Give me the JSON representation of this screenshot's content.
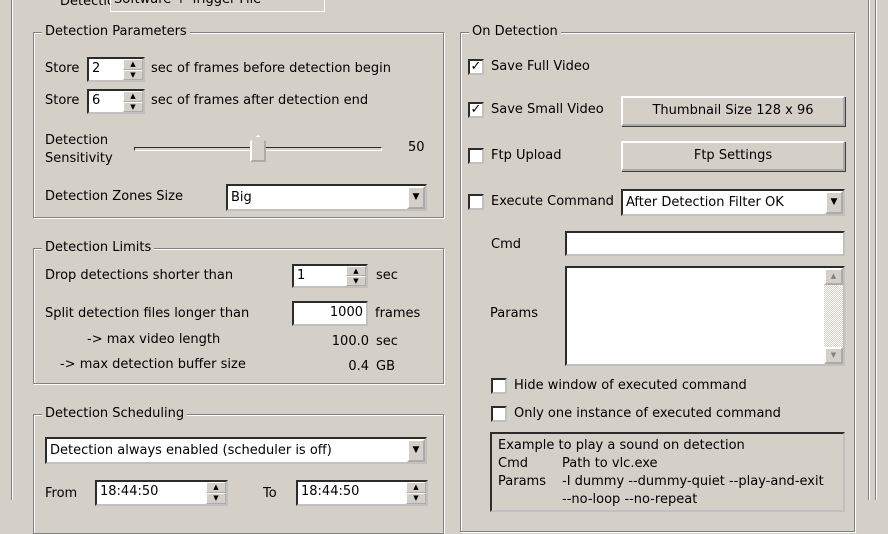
{
  "top": {
    "detection_label": "Detection",
    "detection_value": "Software + Trigger File"
  },
  "params": {
    "title": "Detection Parameters",
    "store_label": "Store",
    "store_before": "2",
    "before_text": "sec of frames before detection begin",
    "store_after": "6",
    "after_text": "sec of frames after detection end",
    "sensitivity_label_1": "Detection",
    "sensitivity_label_2": "Sensitivity",
    "sensitivity_value": "50",
    "sensitivity_fraction": 0.5,
    "zones_label": "Detection Zones Size",
    "zones_value": "Big"
  },
  "limits": {
    "title": "Detection Limits",
    "drop_label": "Drop detections shorter than",
    "drop_value": "1",
    "drop_unit": "sec",
    "split_label": "Split detection files longer than",
    "split_value": "1000",
    "split_unit": "frames",
    "max_video_label": "-> max video length",
    "max_video_value": "100.0",
    "max_video_unit": "sec",
    "max_buffer_label": "-> max detection buffer size",
    "max_buffer_value": "0.4",
    "max_buffer_unit": "GB"
  },
  "scheduling": {
    "title": "Detection Scheduling",
    "mode": "Detection always enabled (scheduler is off)",
    "from_label": "From",
    "from_value": "18:44:50",
    "to_label": "To",
    "to_value": "18:44:50"
  },
  "on_detection": {
    "title": "On Detection",
    "save_full": "Save Full Video",
    "save_small": "Save Small Video",
    "thumb_button": "Thumbnail Size 128 x 96",
    "ftp_upload": "Ftp Upload",
    "ftp_button": "Ftp Settings",
    "exec_cmd": "Execute Command",
    "exec_when": "After Detection Filter OK",
    "cmd_label": "Cmd",
    "cmd_value": "",
    "params_label": "Params",
    "params_value": "",
    "hide_window": "Hide window of executed command",
    "one_instance": "Only one instance of executed command",
    "example": [
      "Example to play a sound on detection",
      "Cmd",
      "Path to vlc.exe",
      "Params",
      "-I dummy --dummy-quiet --play-and-exit",
      "--no-loop --no-repeat"
    ]
  }
}
